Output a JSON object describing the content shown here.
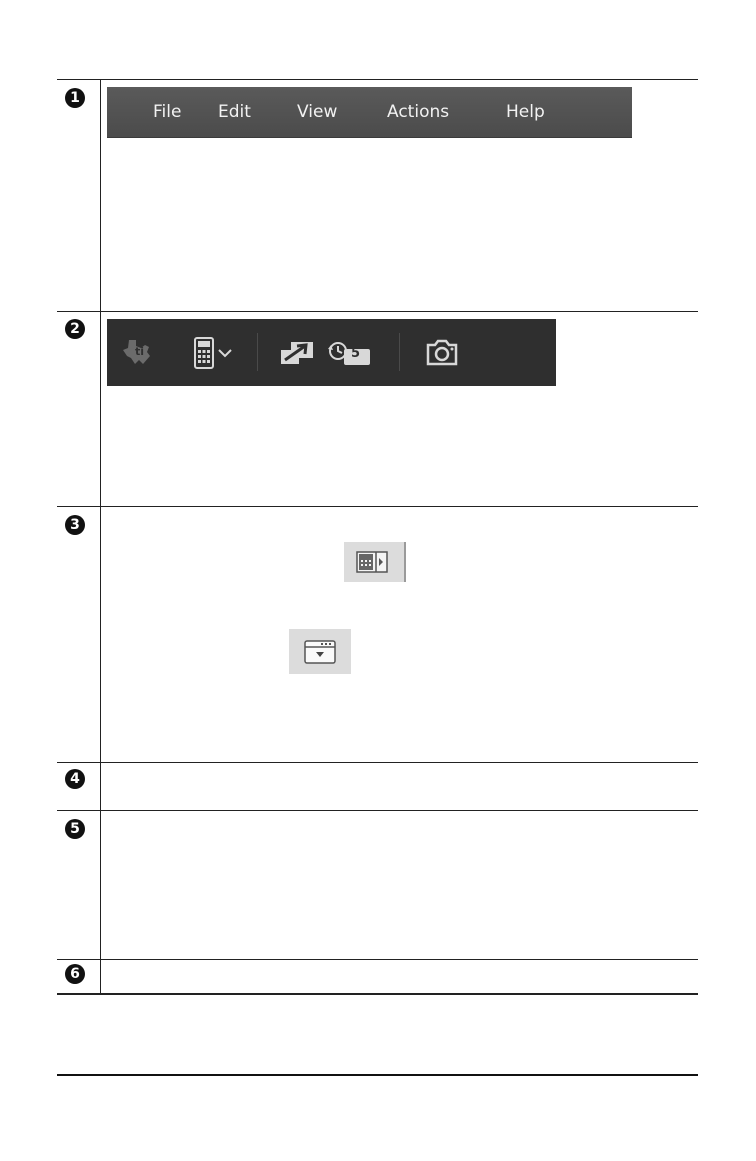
{
  "rows": [
    {
      "number": "1"
    },
    {
      "number": "2"
    },
    {
      "number": "3"
    },
    {
      "number": "4"
    },
    {
      "number": "5"
    },
    {
      "number": "6"
    }
  ],
  "menubar": {
    "items": [
      "File",
      "Edit",
      "View",
      "Actions",
      "Help"
    ]
  },
  "toolbar": {
    "icons": [
      "ti-logo-icon",
      "calculator-dropdown-icon",
      "resize-icon",
      "restore-timer-icon",
      "camera-icon"
    ],
    "timer_value": "5"
  },
  "row3": {
    "icons": [
      "calculator-side-panel-icon",
      "keypad-toggle-icon"
    ]
  },
  "colors": {
    "menubar_bg": "#505050",
    "toolbar_bg": "#2f2f2f",
    "button_bg": "#dcdcdc"
  }
}
